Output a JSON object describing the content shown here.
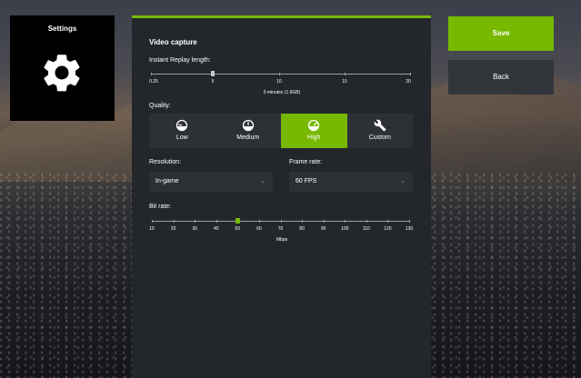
{
  "settings_tile": {
    "title": "Settings",
    "icon": "gear-icon"
  },
  "panel": {
    "title": "Video capture",
    "replay": {
      "label": "Instant Replay length:",
      "ticks": [
        "0.25",
        "5",
        "10",
        "15",
        "20"
      ],
      "value_text": "5 minutes (1.9GB)",
      "value_minutes": 5
    },
    "quality": {
      "label": "Quality:",
      "options": [
        {
          "label": "Low",
          "icon": "gauge-low-icon"
        },
        {
          "label": "Medium",
          "icon": "gauge-medium-icon"
        },
        {
          "label": "High",
          "icon": "gauge-high-icon"
        },
        {
          "label": "Custom",
          "icon": "wrench-icon"
        }
      ],
      "selected": "High"
    },
    "resolution": {
      "label": "Resolution:",
      "value": "In-game"
    },
    "frame_rate": {
      "label": "Frame rate:",
      "value": "60 FPS"
    },
    "bitrate": {
      "label": "Bit rate:",
      "ticks": [
        "10",
        "20",
        "30",
        "40",
        "50",
        "60",
        "70",
        "80",
        "90",
        "100",
        "110",
        "120",
        "130"
      ],
      "unit": "Mbps",
      "value": 50
    }
  },
  "buttons": {
    "save": "Save",
    "back": "Back"
  },
  "colors": {
    "accent": "#76b900",
    "panel": "#23272c",
    "control": "#2d3136"
  }
}
